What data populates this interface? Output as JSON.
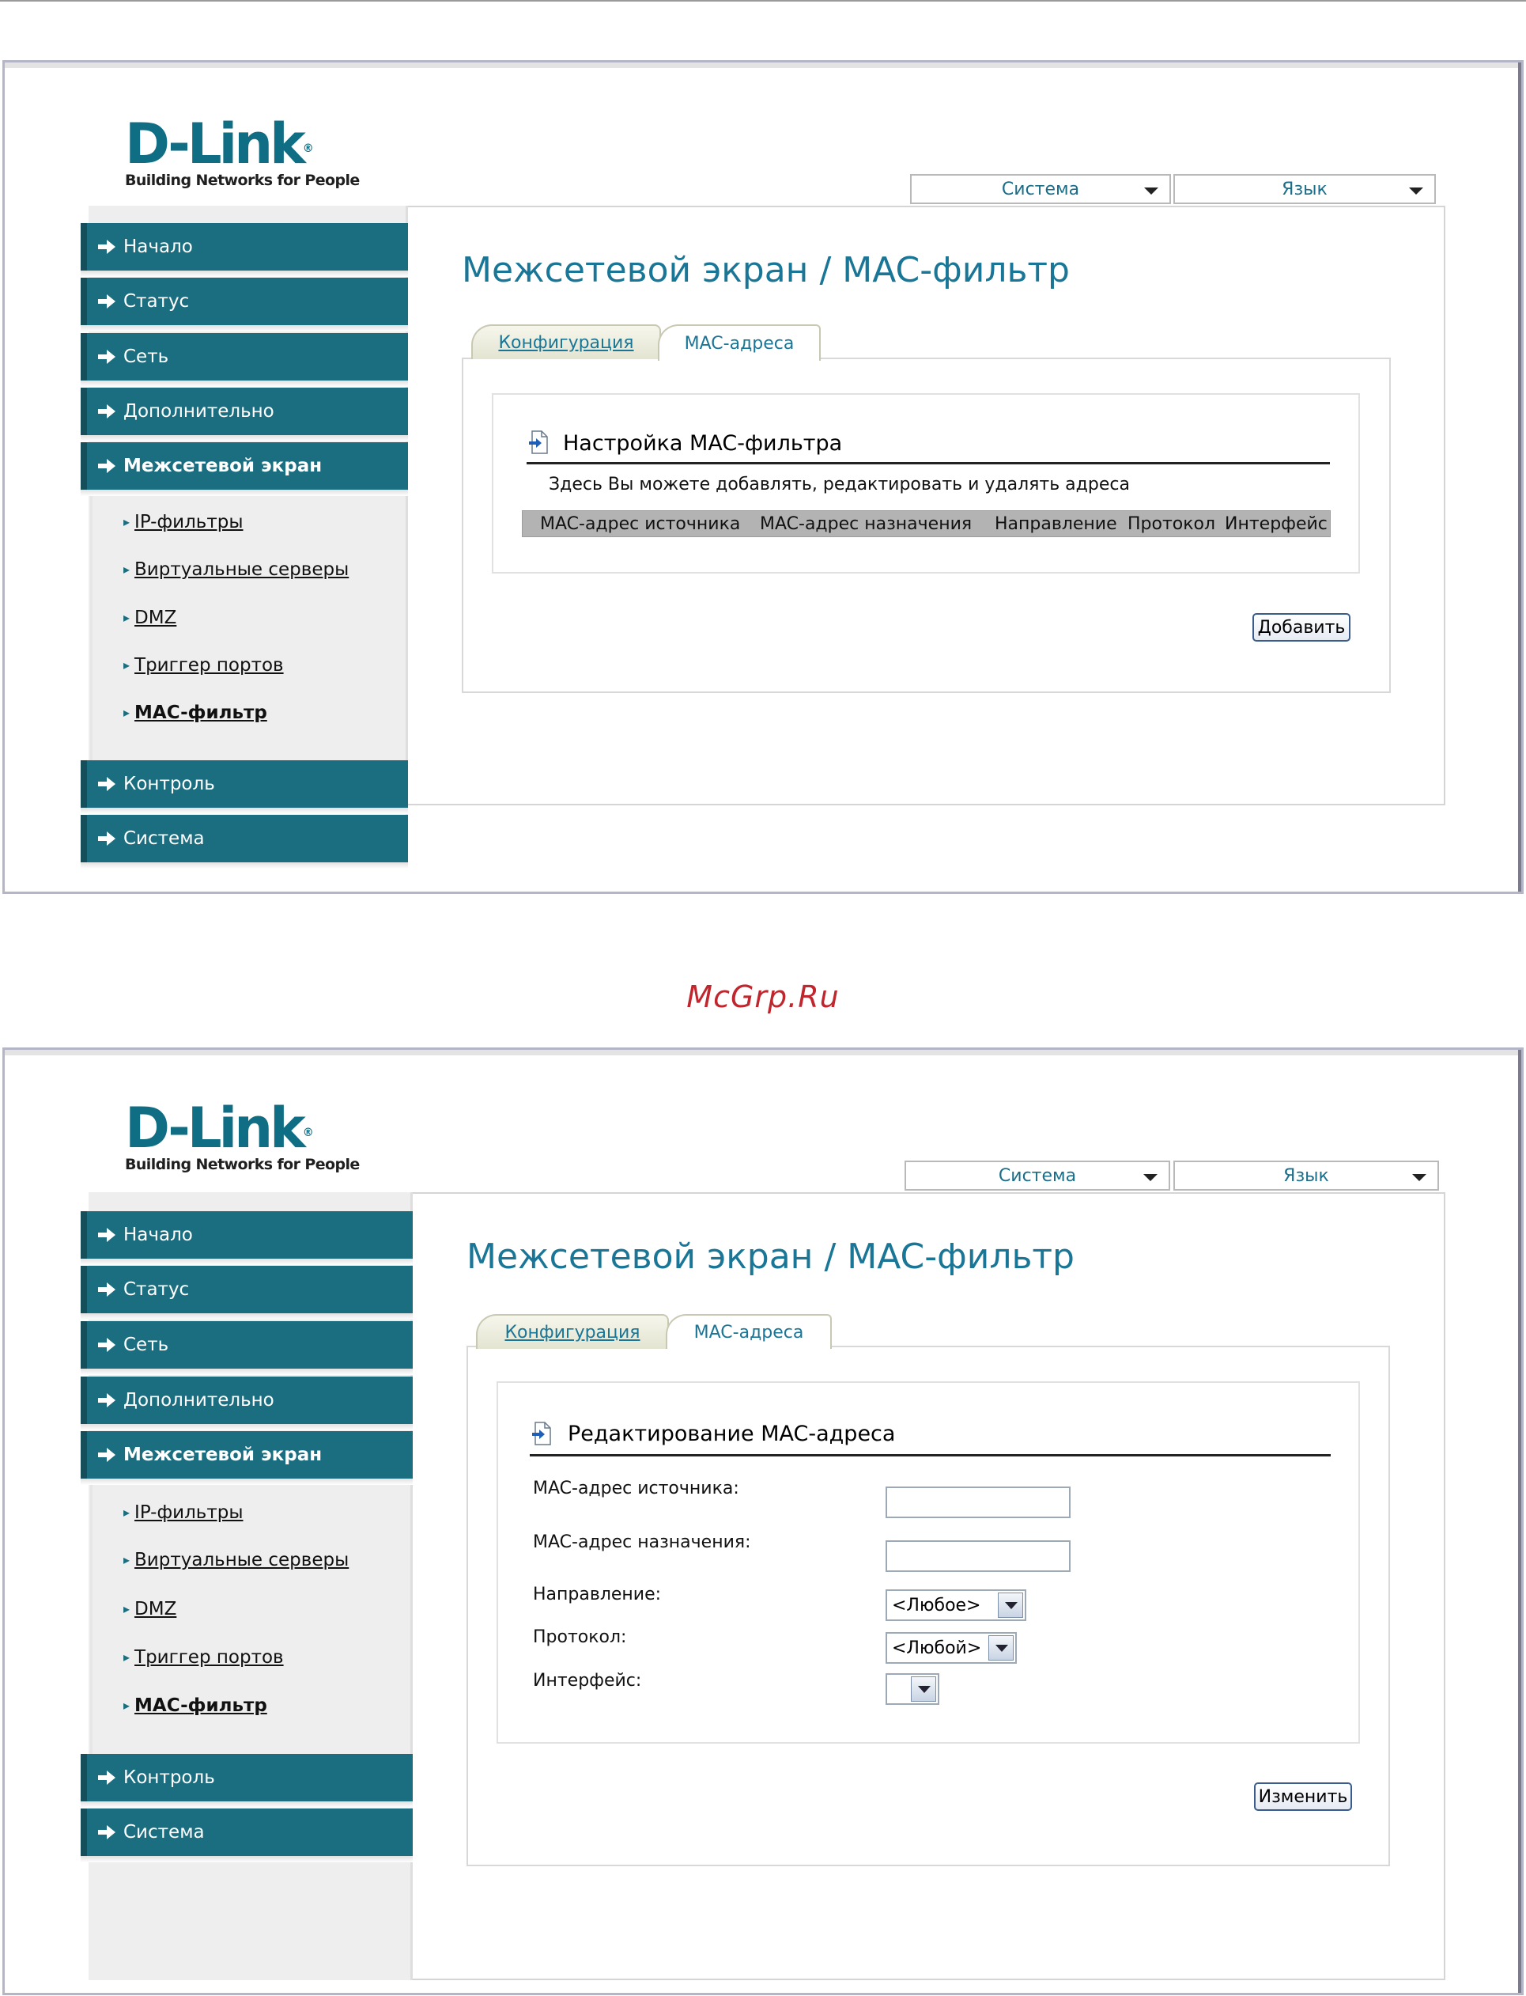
{
  "watermark": "McGrp.Ru",
  "brand": {
    "name": "D-Link",
    "tagline": "Building Networks for People"
  },
  "top_selects": {
    "system": "Система",
    "language": "Язык"
  },
  "menu": {
    "items": [
      "Начало",
      "Статус",
      "Сеть",
      "Дополнительно",
      "Межсетевой экран"
    ],
    "bottom_items": [
      "Контроль",
      "Система"
    ],
    "sub_items": [
      "IP-фильтры",
      "Виртуальные серверы",
      "DMZ",
      "Триггер портов",
      "MAC-фильтр"
    ]
  },
  "page_title": "Межсетевой экран /  MAC-фильтр",
  "tabs": [
    "Конфигурация",
    "MAC-адреса"
  ],
  "screen1": {
    "section_title": "Настройка MAC-фильтра",
    "description": "Здесь Вы можете добавлять, редактировать и удалять адреса",
    "table_headers": [
      "MAC-адрес источника",
      "MAC-адрес назначения",
      "Направление",
      "Протокол",
      "Интерфейс"
    ],
    "add_button": "Добавить"
  },
  "screen2": {
    "section_title": "Редактирование MAC-адреса",
    "fields": {
      "src_label": "MAC-адрес источника:",
      "dst_label": "MAC-адрес назначения:",
      "direction_label": "Направление:",
      "direction_value": "<Любое>",
      "protocol_label": "Протокол:",
      "protocol_value": "<Любой>",
      "interface_label": "Интерфейс:",
      "interface_value": ""
    },
    "edit_button": "Изменить"
  },
  "colors": {
    "menu_bg": "#1b6e7f",
    "title": "#1a7696",
    "logo": "#0f6d84",
    "watermark": "#c0262d"
  }
}
